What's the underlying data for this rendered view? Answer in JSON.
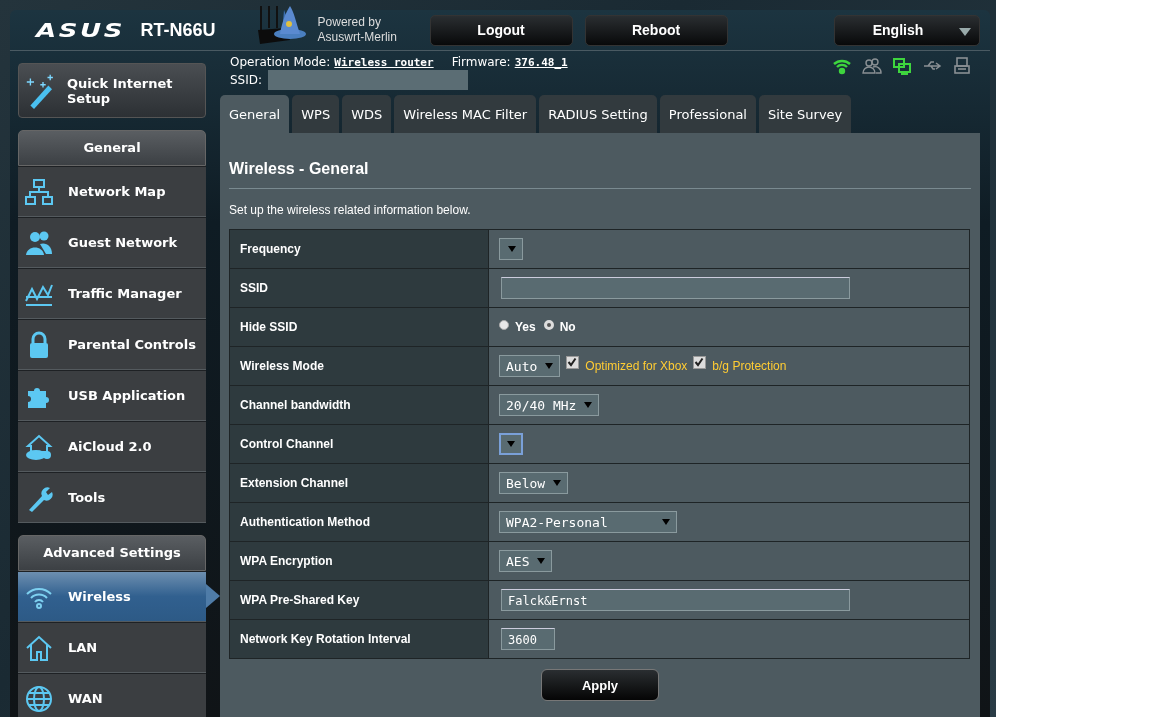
{
  "header": {
    "logo": "ASUS",
    "model": "RT-N66U",
    "powered_by": "Powered by",
    "firmware_name": "Asuswrt-Merlin",
    "buttons": [
      "Logout",
      "Reboot"
    ],
    "language": "English"
  },
  "info": {
    "operation_mode_label": "Operation Mode:",
    "operation_mode": "Wireless router",
    "firmware_label": "Firmware:",
    "firmware": "376.48_1",
    "ssid_label": "SSID:"
  },
  "status_icons": [
    {
      "kind": "wifi",
      "on": true
    },
    {
      "kind": "guests",
      "on": false
    },
    {
      "kind": "clients",
      "on": true
    },
    {
      "kind": "usb",
      "on": false
    },
    {
      "kind": "printer",
      "on": false
    }
  ],
  "quick_setup": "Quick Internet Setup",
  "sidebar": [
    {
      "title": "General",
      "items": [
        {
          "label": "Network Map",
          "selected": false
        },
        {
          "label": "Guest Network",
          "selected": false
        },
        {
          "label": "Traffic Manager",
          "selected": false
        },
        {
          "label": "Parental Controls",
          "selected": false
        },
        {
          "label": "USB Application",
          "selected": false
        },
        {
          "label": "AiCloud 2.0",
          "selected": false
        },
        {
          "label": "Tools",
          "selected": false
        }
      ]
    },
    {
      "title": "Advanced Settings",
      "items": [
        {
          "label": "Wireless",
          "selected": true
        },
        {
          "label": "LAN",
          "selected": false
        },
        {
          "label": "WAN",
          "selected": false
        }
      ]
    }
  ],
  "tabs": [
    {
      "label": "General",
      "selected": true
    },
    {
      "label": "WPS",
      "selected": false
    },
    {
      "label": "WDS",
      "selected": false
    },
    {
      "label": "Wireless MAC Filter",
      "selected": false
    },
    {
      "label": "RADIUS Setting",
      "selected": false
    },
    {
      "label": "Professional",
      "selected": false
    },
    {
      "label": "Site Survey",
      "selected": false
    }
  ],
  "page": {
    "title": "Wireless - General",
    "description": "Set up the wireless related information below."
  },
  "settings": [
    {
      "label": "Frequency",
      "kind": "select",
      "focused": false
    },
    {
      "label": "SSID",
      "kind": "text"
    },
    {
      "label": "Hide SSID",
      "kind": "radio",
      "options": [
        {
          "label": "Yes",
          "selected": false
        },
        {
          "label": "No",
          "selected": true
        }
      ]
    },
    {
      "label": "Wireless Mode",
      "kind": "select",
      "value": "Auto",
      "focused": false,
      "checks": [
        {
          "label": "Optimized for Xbox",
          "checked": true
        },
        {
          "label": "b/g Protection",
          "checked": true
        }
      ]
    },
    {
      "label": "Channel bandwidth",
      "kind": "select",
      "value": "20/40 MHz",
      "focused": false
    },
    {
      "label": "Control Channel",
      "kind": "select",
      "focused": true
    },
    {
      "label": "Extension Channel",
      "kind": "select",
      "value": "Below",
      "focused": false
    },
    {
      "label": "Authentication Method",
      "kind": "select",
      "value": "WPA2-Personal",
      "focused": false
    },
    {
      "label": "WPA Encryption",
      "kind": "select",
      "value": "AES",
      "focused": false
    },
    {
      "label": "WPA Pre-Shared Key",
      "kind": "text",
      "value": "Falck&Ernst"
    },
    {
      "label": "Network Key Rotation Interval",
      "kind": "text",
      "value": "3600"
    }
  ],
  "apply": "Apply"
}
